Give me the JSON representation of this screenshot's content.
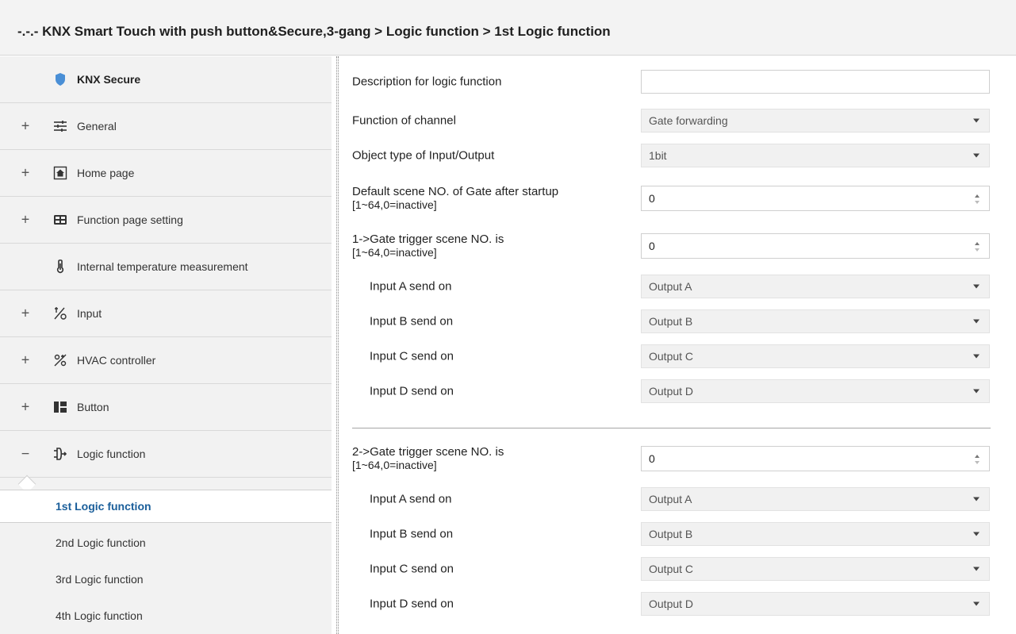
{
  "window": {
    "title": "-.-.- KNX Smart Touch with push button&Secure,3-gang > Logic function > 1st Logic function"
  },
  "sidebar": {
    "items": [
      {
        "label": "KNX Secure",
        "icon": "shield-icon",
        "expander": ""
      },
      {
        "label": "General",
        "icon": "sliders-icon",
        "expander": "+"
      },
      {
        "label": "Home page",
        "icon": "home-icon",
        "expander": "+"
      },
      {
        "label": "Function page setting",
        "icon": "grid-icon",
        "expander": "+"
      },
      {
        "label": "Internal temperature measurement",
        "icon": "thermometer-icon",
        "expander": ""
      },
      {
        "label": "Input",
        "icon": "input-icon",
        "expander": "+"
      },
      {
        "label": "HVAC controller",
        "icon": "hvac-icon",
        "expander": "+"
      },
      {
        "label": "Button",
        "icon": "button-icon",
        "expander": "+"
      },
      {
        "label": "Logic function",
        "icon": "logic-icon",
        "expander": "−"
      }
    ],
    "subitems": [
      {
        "label": "1st Logic function",
        "active": true
      },
      {
        "label": "2nd Logic function",
        "active": false
      },
      {
        "label": "3rd Logic function",
        "active": false
      },
      {
        "label": "4th Logic function",
        "active": false
      }
    ],
    "accent_color": "#1a5e9a",
    "shield_color": "#4a8fd6"
  },
  "params": {
    "description": {
      "label": "Description for logic function",
      "value": ""
    },
    "function_channel": {
      "label": "Function of channel",
      "value": "Gate forwarding"
    },
    "object_type": {
      "label": "Object type of Input/Output",
      "value": "1bit"
    },
    "default_scene": {
      "label_line1": "Default scene NO. of Gate after startup",
      "label_line2": "[1~64,0=inactive]",
      "value": "0"
    },
    "gate1": {
      "label_line1": "1->Gate trigger scene NO. is",
      "label_line2": "[1~64,0=inactive]",
      "value": "0",
      "inputs": [
        {
          "label": "Input A send on",
          "value": "Output A"
        },
        {
          "label": "Input B send on",
          "value": "Output B"
        },
        {
          "label": "Input C send on",
          "value": "Output C"
        },
        {
          "label": "Input D send on",
          "value": "Output D"
        }
      ]
    },
    "gate2": {
      "label_line1": "2->Gate trigger scene NO. is",
      "label_line2": "[1~64,0=inactive]",
      "value": "0",
      "inputs": [
        {
          "label": "Input A send on",
          "value": "Output A"
        },
        {
          "label": "Input B send on",
          "value": "Output B"
        },
        {
          "label": "Input C send on",
          "value": "Output C"
        },
        {
          "label": "Input D send on",
          "value": "Output D"
        }
      ]
    }
  }
}
